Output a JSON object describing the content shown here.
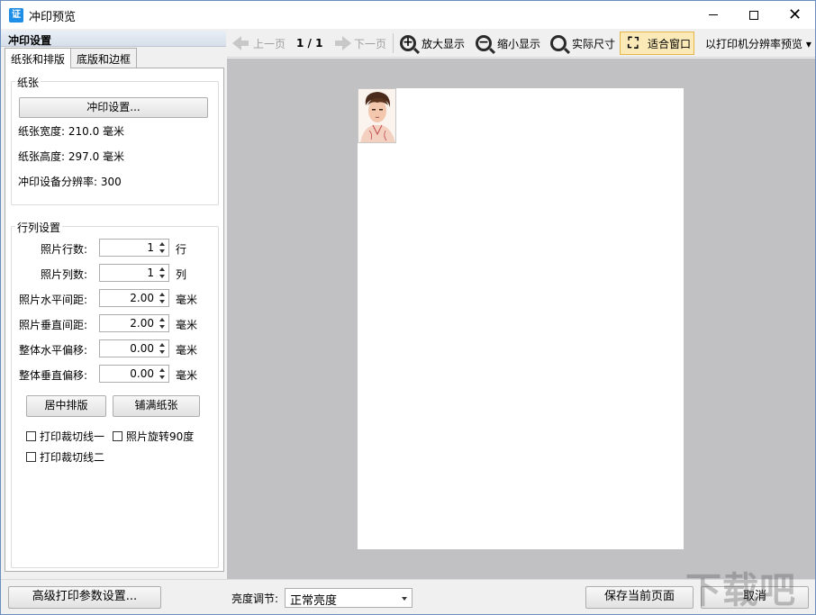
{
  "window": {
    "title": "冲印预览",
    "app_icon_text": "证",
    "close_glyph": "✕"
  },
  "left": {
    "panel_title": "冲印设置",
    "tabs": [
      {
        "label": "纸张和排版",
        "active": true
      },
      {
        "label": "底版和边框",
        "active": false
      }
    ],
    "paper_group": {
      "title": "纸张",
      "print_settings_button": "冲印设置...",
      "width_label": "纸张宽度: 210.0 毫米",
      "height_label": "纸张高度: 297.0 毫米",
      "resolution_label": "冲印设备分辨率: 300"
    },
    "layout_group": {
      "title": "行列设置",
      "rows": [
        {
          "label": "照片行数:",
          "value": "1",
          "unit": "行"
        },
        {
          "label": "照片列数:",
          "value": "1",
          "unit": "列"
        },
        {
          "label": "照片水平间距:",
          "value": "2.00",
          "unit": "毫米"
        },
        {
          "label": "照片垂直间距:",
          "value": "2.00",
          "unit": "毫米"
        },
        {
          "label": "整体水平偏移:",
          "value": "0.00",
          "unit": "毫米"
        },
        {
          "label": "整体垂直偏移:",
          "value": "0.00",
          "unit": "毫米"
        }
      ],
      "center_button": "居中排版",
      "fill_button": "铺满纸张",
      "checkboxes": [
        {
          "label": "打印裁切线一",
          "checked": false
        },
        {
          "label": "照片旋转90度",
          "checked": false
        },
        {
          "label": "打印裁切线二",
          "checked": false
        }
      ]
    }
  },
  "toolbar": {
    "prev_page": "上一页",
    "page_indicator": "1 / 1",
    "next_page": "下一页",
    "zoom_in": "放大显示",
    "zoom_out": "缩小显示",
    "actual_size": "实际尺寸",
    "fit_window": "适合窗口",
    "printer_resolution_preview": "以打印机分辨率预览 ▾"
  },
  "preview": {
    "background_color": "#c1c1c4",
    "paper_color": "#ffffff",
    "photo_count": 1
  },
  "bottom": {
    "advanced_button": "高级打印参数设置...",
    "brightness_label": "亮度调节:",
    "brightness_value": "正常亮度",
    "save_button": "保存当前页面",
    "cancel_button": "取消",
    "watermark": "下载吧"
  },
  "icons": {
    "zoom_in": "zoom-in-icon",
    "zoom_out": "zoom-out-icon",
    "actual_size": "magnifier-icon",
    "fit_window": "fit-window-icon"
  }
}
